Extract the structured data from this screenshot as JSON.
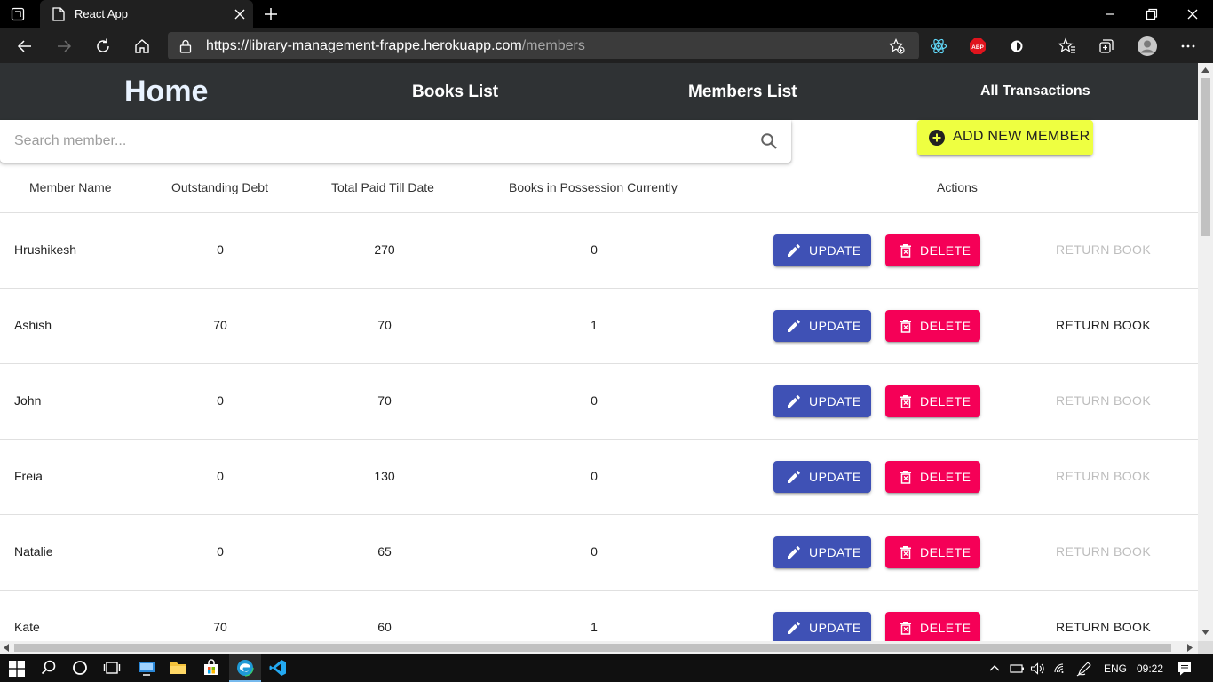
{
  "browser": {
    "tab_title": "React App",
    "url_host": "https://library-management-frappe.herokuapp.com",
    "url_path": "/members",
    "extension_badge": "ABP"
  },
  "nav": {
    "home": "Home",
    "books": "Books List",
    "members": "Members List",
    "transactions": "All Transactions"
  },
  "search": {
    "placeholder": "Search member..."
  },
  "add_button": "ADD NEW MEMBER",
  "table": {
    "headers": [
      "Member Name",
      "Outstanding Debt",
      "Total Paid Till Date",
      "Books in Possession Currently",
      "Actions"
    ],
    "update_label": "UPDATE",
    "delete_label": "DELETE",
    "return_label": "RETURN BOOK",
    "rows": [
      {
        "name": "Hrushikesh",
        "debt": "0",
        "paid": "270",
        "books": "0",
        "return_enabled": false
      },
      {
        "name": "Ashish",
        "debt": "70",
        "paid": "70",
        "books": "1",
        "return_enabled": true
      },
      {
        "name": "John",
        "debt": "0",
        "paid": "70",
        "books": "0",
        "return_enabled": false
      },
      {
        "name": "Freia",
        "debt": "0",
        "paid": "130",
        "books": "0",
        "return_enabled": false
      },
      {
        "name": "Natalie",
        "debt": "0",
        "paid": "65",
        "books": "0",
        "return_enabled": false
      },
      {
        "name": "Kate",
        "debt": "70",
        "paid": "60",
        "books": "1",
        "return_enabled": true
      }
    ]
  },
  "taskbar": {
    "language": "ENG",
    "time": "09:22"
  },
  "colors": {
    "navbar": "#2f3234",
    "update": "#3f51b5",
    "delete": "#f50057",
    "add": "#eeff41"
  }
}
